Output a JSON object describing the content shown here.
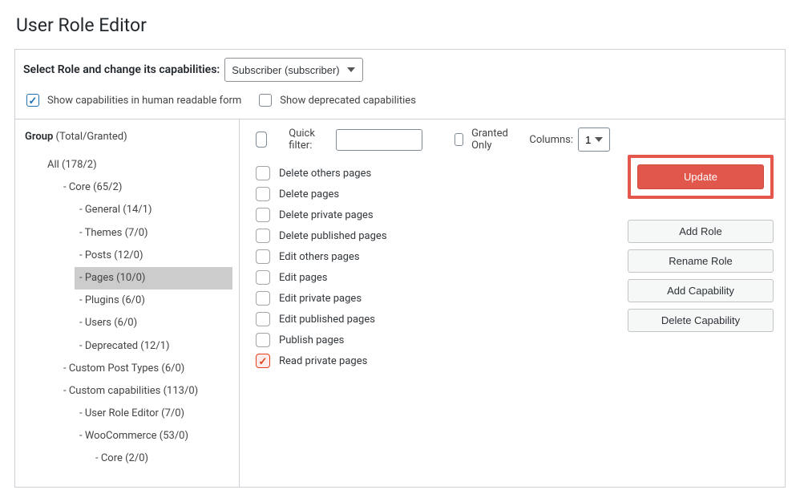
{
  "page_title": "User Role Editor",
  "select_row": {
    "label": "Select Role and change its capabilities:",
    "role_value": "Subscriber (subscriber)"
  },
  "opts": {
    "human_readable": {
      "label": "Show capabilities in human readable form",
      "checked": true
    },
    "deprecated": {
      "label": "Show deprecated capabilities",
      "checked": false
    }
  },
  "sidebar": {
    "header_label": "Group",
    "header_suffix": "(Total/Granted)",
    "items": [
      {
        "label": "All (178/2)",
        "level": "lv0"
      },
      {
        "label": "- Core (65/2)",
        "level": "lv1"
      },
      {
        "label": "- General (14/1)",
        "level": "lv2"
      },
      {
        "label": "- Themes (7/0)",
        "level": "lv2"
      },
      {
        "label": "- Posts (12/0)",
        "level": "lv2"
      },
      {
        "label": "- Pages (10/0)",
        "level": "lv2",
        "selected": true
      },
      {
        "label": "- Plugins (6/0)",
        "level": "lv2"
      },
      {
        "label": "- Users (6/0)",
        "level": "lv2"
      },
      {
        "label": "- Deprecated (12/1)",
        "level": "lv2"
      },
      {
        "label": "- Custom Post Types (6/0)",
        "level": "lv1"
      },
      {
        "label": "- Custom capabilities (113/0)",
        "level": "lv1"
      },
      {
        "label": "- User Role Editor (7/0)",
        "level": "lv2"
      },
      {
        "label": "- WooCommerce (53/0)",
        "level": "lv2"
      },
      {
        "label": "- Core (2/0)",
        "level": "lv3"
      }
    ]
  },
  "filter": {
    "quick_label": "Quick filter:",
    "quick_value": "",
    "granted_label": "Granted Only",
    "granted_checked": false,
    "columns_label": "Columns:",
    "columns_value": "1"
  },
  "capabilities": [
    {
      "label": "Delete others pages",
      "checked": false
    },
    {
      "label": "Delete pages",
      "checked": false
    },
    {
      "label": "Delete private pages",
      "checked": false
    },
    {
      "label": "Delete published pages",
      "checked": false
    },
    {
      "label": "Edit others pages",
      "checked": false
    },
    {
      "label": "Edit pages",
      "checked": false
    },
    {
      "label": "Edit private pages",
      "checked": false
    },
    {
      "label": "Edit published pages",
      "checked": false
    },
    {
      "label": "Publish pages",
      "checked": false
    },
    {
      "label": "Read private pages",
      "checked": true
    }
  ],
  "actions": {
    "update": "Update",
    "add_role": "Add Role",
    "rename_role": "Rename Role",
    "add_cap": "Add Capability",
    "del_cap": "Delete Capability"
  }
}
